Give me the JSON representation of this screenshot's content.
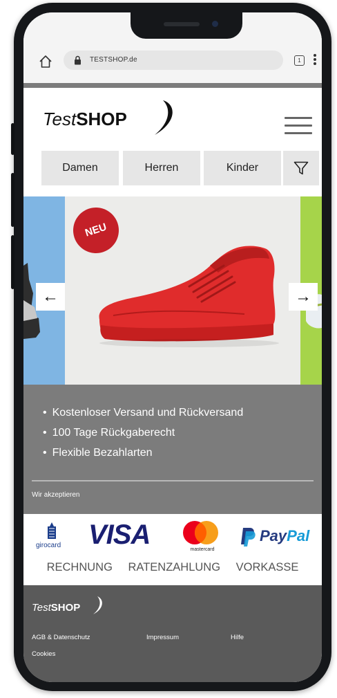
{
  "browser": {
    "url": "TESTSHOP.de",
    "tab_count": "1"
  },
  "header": {
    "logo_test": "Test",
    "logo_shop": "SHOP"
  },
  "nav": {
    "tabs": [
      {
        "label": "Damen"
      },
      {
        "label": "Herren"
      },
      {
        "label": "Kinder"
      }
    ]
  },
  "carousel": {
    "badge": "NEU",
    "prev_arrow": "←",
    "next_arrow": "→",
    "colors": {
      "left_slide": "#7fb5e3",
      "right_slide": "#a6d44a",
      "shoe": "#e02c2c",
      "badge": "#c42028"
    }
  },
  "benefits": {
    "items": [
      "Kostenloser Versand und Rückversand",
      "100 Tage Rückgaberecht",
      "Flexible Bezahlarten"
    ],
    "accept_label": "Wir akzeptieren"
  },
  "payments": {
    "logos": {
      "girocard": "girocard",
      "visa": "VISA",
      "mastercard": "mastercard",
      "paypal_pay": "Pay",
      "paypal_pal": "Pal"
    },
    "methods": [
      "RECHNUNG",
      "RATENZAHLUNG",
      "VORKASSE"
    ]
  },
  "footer": {
    "logo_test": "Test",
    "logo_shop": "SHOP",
    "links": {
      "agb": "AGB & Datenschutz",
      "impressum": "Impressum",
      "hilfe": "Hilfe",
      "cookies": "Cookies"
    }
  },
  "colors": {
    "gray_band": "#7c7c7c",
    "footer": "#5a5a5a",
    "visa_blue": "#1a1f71",
    "paypal_dark": "#253b80",
    "paypal_light": "#179bd7"
  }
}
